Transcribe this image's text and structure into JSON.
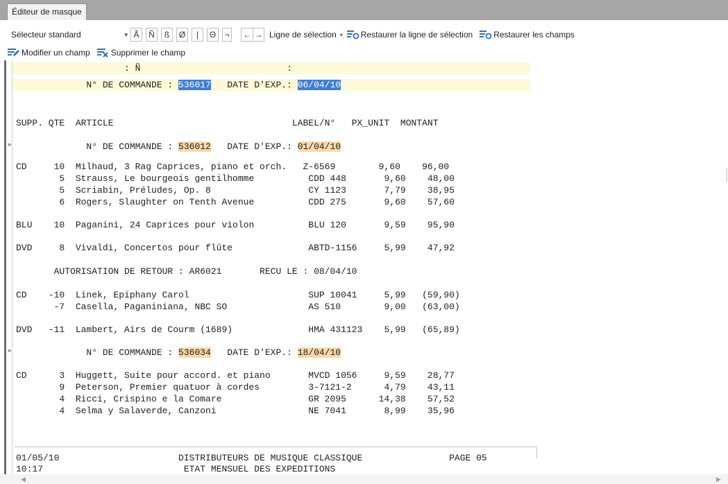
{
  "tab": {
    "title": "Éditeur de masque"
  },
  "toolbar": {
    "selector_value": "Sélecteur standard",
    "char_buttons": [
      "Ã",
      "Ñ",
      "ß",
      "Ø",
      "|",
      "Θ",
      "¬"
    ],
    "nav_left": "←",
    "nav_right": "→",
    "line_select_label": "Ligne de sélection",
    "restore_line_label": "Restaurer la ligne de sélection",
    "restore_fields_label": "Restaurer les champs",
    "modify_field_label": "Modifier un champ",
    "delete_field_label": "Supprimer le champ"
  },
  "mask": {
    "line1_text": "                    : Ñ                           :",
    "line2_prefix": "             N° DE COMMANDE : ",
    "line2_order": "536017",
    "line2_mid": "   DATE D'EXP.: ",
    "line2_date": "06/04/10"
  },
  "report": {
    "header": "SUPP. QTE  ARTICLE                                 LABEL/N°   PX_UNIT  MONTANT",
    "orders": [
      {
        "prefix": "             N° DE COMMANDE : ",
        "order": "536012",
        "mid": "   DATE D'EXP.: ",
        "date": "01/04/10"
      },
      {
        "prefix": "             N° DE COMMANDE : ",
        "order": "536034",
        "mid": "   DATE D'EXP.: ",
        "date": "18/04/10"
      }
    ],
    "lines": [
      "CD     10  Milhaud, 3 Rag Caprices, piano et orch.   Z-6569        9,60    96,00",
      "        5  Strauss, Le bourgeois gentilhomme          CDD 448       9,60    48,00",
      "        5  Scriabin, Préludes, Op. 8                  CY 1123       7,79    38,95",
      "        6  Rogers, Slaughter on Tenth Avenue          CDD 275       9,60    57,60",
      "BLU    10  Paganini, 24 Caprices pour violon          BLU 120       9,59    95,90",
      "DVD     8  Vivaldi, Concertos pour flûte              ABTD-1156     5,99    47,92",
      "       AUTORISATION DE RETOUR : AR6021       RECU LE : 08/04/10",
      "CD    -10  Linek, Epiphany Carol                      SUP 10041     5,99   (59,90)",
      "       -7  Casella, Paganiniana, NBC SO               AS 510        9,00   (63,00)",
      "DVD   -11  Lambert, Airs de Courm (1689)              HMA 431123    5,99   (65,89)",
      "CD      3  Huggett, Suite pour accord. et piano       MVCD 1056     9,59    28,77",
      "        9  Peterson, Premier quatuor à cordes         3-7121-2      4,79    43,11",
      "        4  Ricci, Crispino e la Comare                GR 2095      14,38    57,52",
      "        4  Selma y Salaverde, Canzoni                 NE 7041       8,99    35,96"
    ],
    "footer1": "01/05/10                      DISTRIBUTEURS DE MUSIQUE CLASSIQUE                PAGE 05",
    "footer2": "10:17                          ETAT MENSUEL DES EXPEDITIONS"
  },
  "scroll": {
    "left_arrow": "◀",
    "right_arrow": "▶"
  },
  "markers": {
    "row_arrow": "»"
  },
  "colors": {
    "selection": "#3d7ed6",
    "highlight": "#fbd8a8",
    "mask_band": "#fef9d6",
    "tabstrip": "#a6a6a6",
    "icon_blue": "#2f6fc1"
  }
}
